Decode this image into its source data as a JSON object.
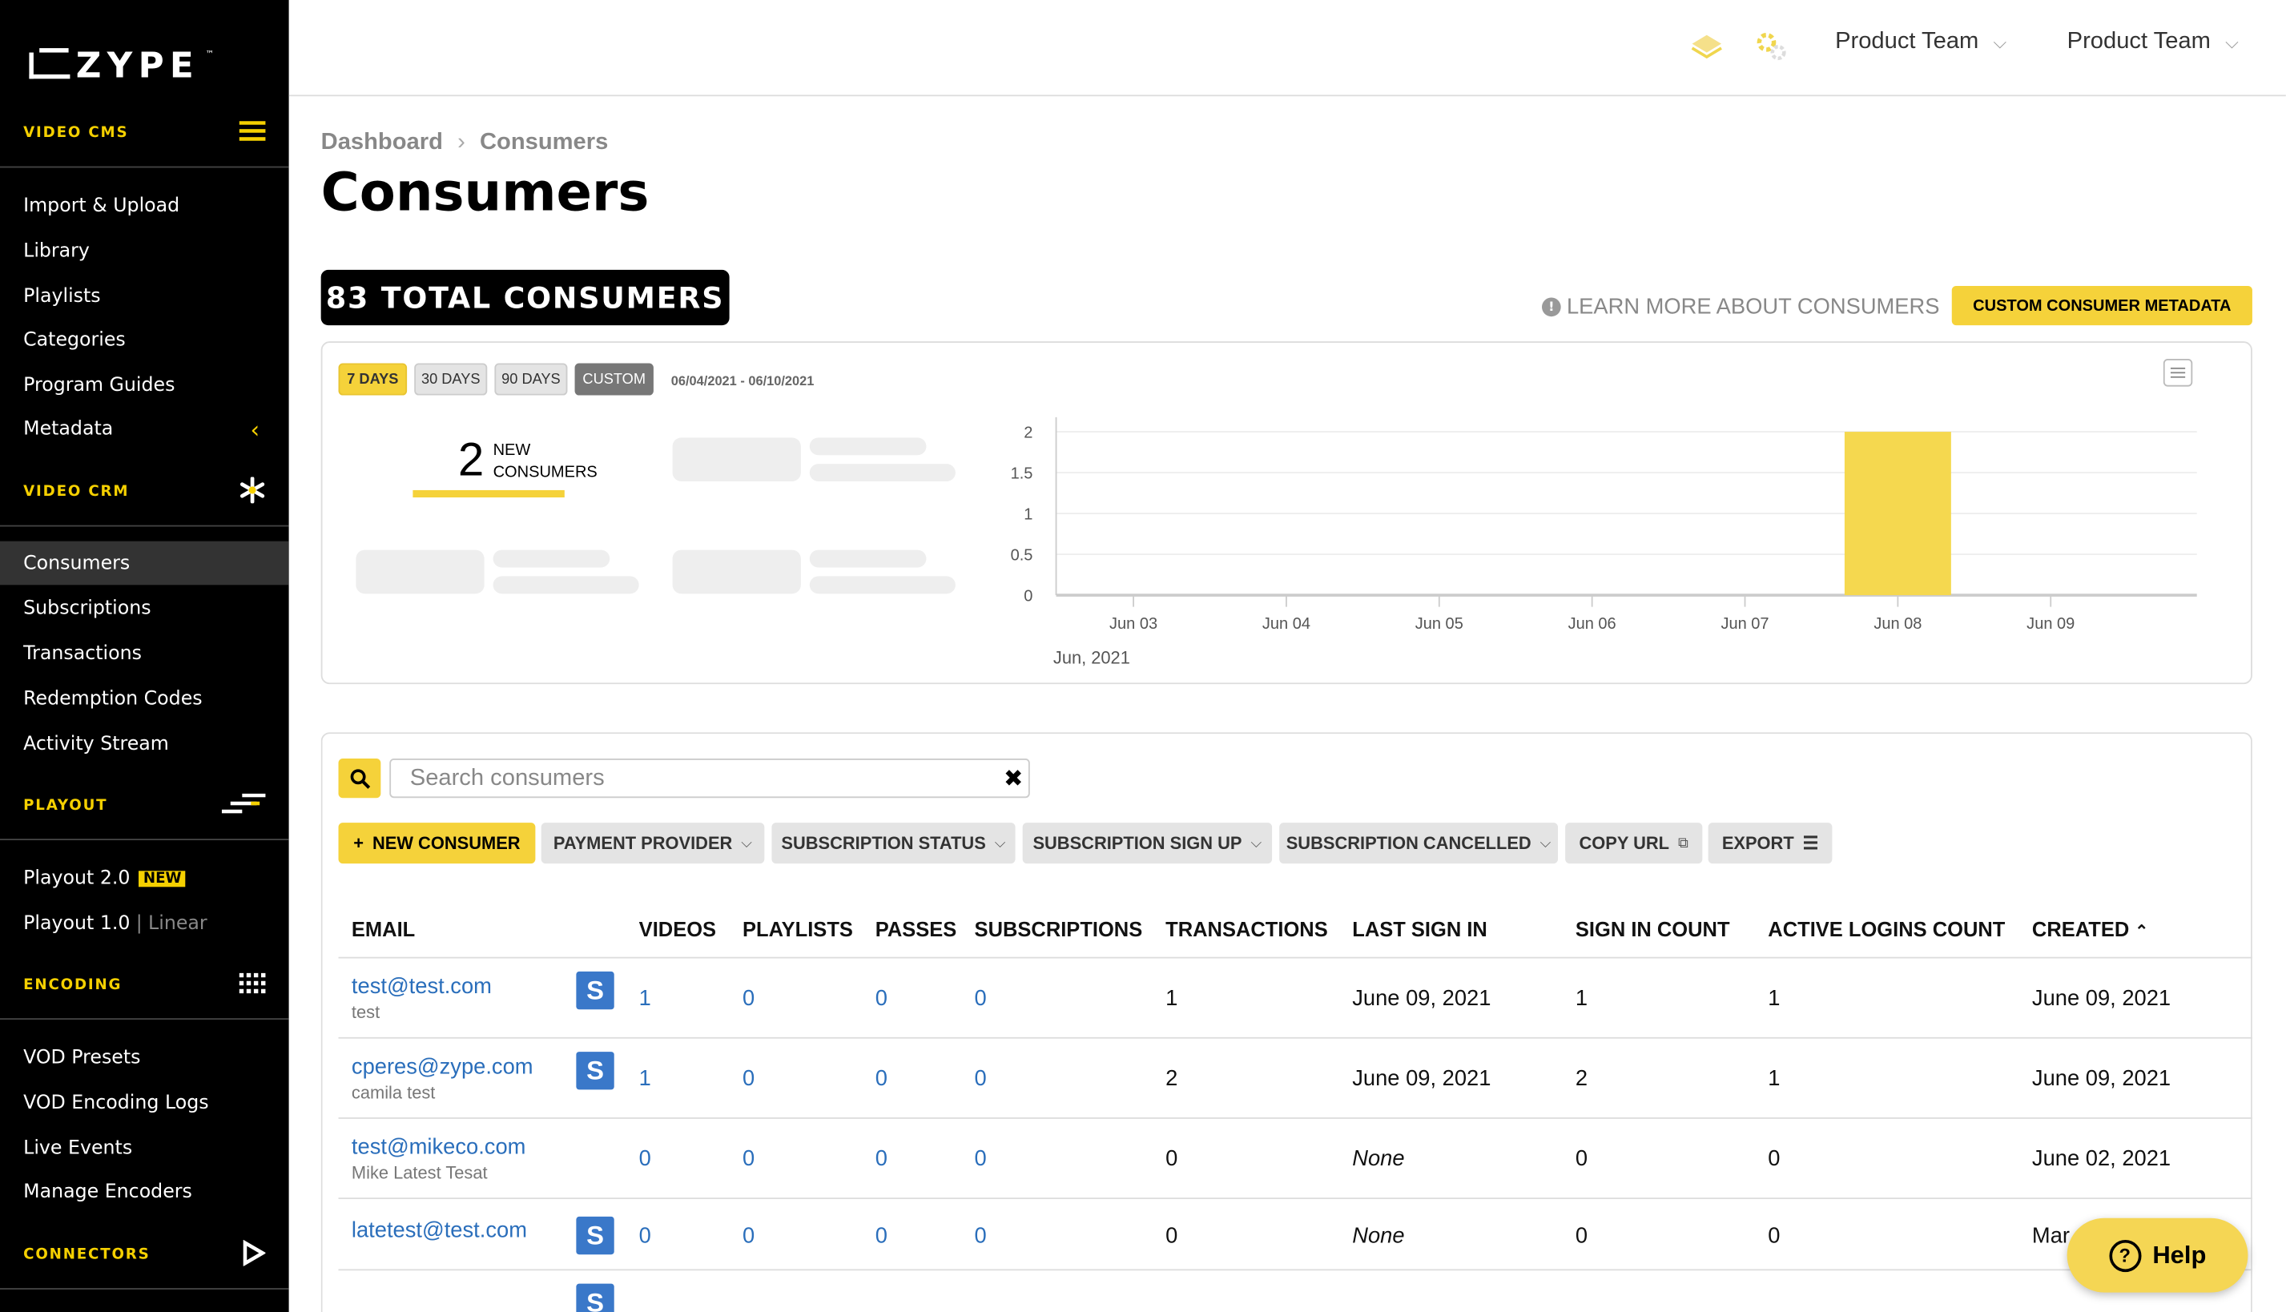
{
  "brand": {
    "name": "ZYPE",
    "tm": "™"
  },
  "sidebar": {
    "sections": [
      {
        "label": "VIDEO CMS",
        "icon": "hamburger-icon"
      },
      {
        "label": "VIDEO CRM",
        "icon": "asterisk-icon"
      },
      {
        "label": "PLAYOUT",
        "icon": "playout-icon"
      },
      {
        "label": "ENCODING",
        "icon": "grid-icon"
      },
      {
        "label": "CONNECTORS",
        "icon": "play-icon"
      }
    ],
    "cms_items": [
      "Import & Upload",
      "Library",
      "Playlists",
      "Categories",
      "Program Guides",
      "Metadata"
    ],
    "crm_items": [
      "Consumers",
      "Subscriptions",
      "Transactions",
      "Redemption Codes",
      "Activity Stream"
    ],
    "playout_items": [
      {
        "label": "Playout 2.0",
        "badge": "NEW"
      },
      {
        "label": "Playout 1.0",
        "sep": "|",
        "extra": "Linear"
      }
    ],
    "encoding_items": [
      "VOD Presets",
      "VOD Encoding Logs",
      "Live Events",
      "Manage Encoders"
    ]
  },
  "topbar": {
    "team1": "Product Team",
    "team2": "Product Team"
  },
  "breadcrumb": {
    "root": "Dashboard",
    "current": "Consumers"
  },
  "page_title": "Consumers",
  "total_badge": "83 TOTAL CONSUMERS",
  "learn_more": "LEARN MORE ABOUT CONSUMERS",
  "custom_meta_button": "CUSTOM CONSUMER METADATA",
  "ranges": [
    "7 DAYS",
    "30 DAYS",
    "90 DAYS",
    "CUSTOM"
  ],
  "selected_range": "7 DAYS",
  "date_range": "06/04/2021 - 06/10/2021",
  "stat": {
    "value": "2",
    "label_line1": "NEW",
    "label_line2": "CONSUMERS"
  },
  "chart_data": {
    "type": "bar",
    "categories": [
      "Jun 03",
      "Jun 04",
      "Jun 05",
      "Jun 06",
      "Jun 07",
      "Jun 08",
      "Jun 09"
    ],
    "values": [
      0,
      0,
      0,
      0,
      0,
      2,
      0
    ],
    "y_ticks": [
      "0",
      "0.5",
      "1",
      "1.5",
      "2"
    ],
    "ylim": [
      0,
      2
    ],
    "xlabel": "Jun, 2021",
    "grid": true,
    "bar_color": "#f5d84f"
  },
  "search": {
    "placeholder": "Search consumers",
    "clear": "✖"
  },
  "filters": {
    "new_consumer": "NEW CONSUMER",
    "payment_provider": "PAYMENT PROVIDER",
    "subscription_status": "SUBSCRIPTION STATUS",
    "subscription_sign_up": "SUBSCRIPTION SIGN UP",
    "subscription_cancelled": "SUBSCRIPTION CANCELLED",
    "copy_url": "COPY URL",
    "export": "EXPORT"
  },
  "table": {
    "headers": [
      "EMAIL",
      "VIDEOS",
      "PLAYLISTS",
      "PASSES",
      "SUBSCRIPTIONS",
      "TRANSACTIONS",
      "LAST SIGN IN",
      "SIGN IN COUNT",
      "ACTIVE LOGINS COUNT",
      "CREATED"
    ],
    "rows": [
      {
        "email": "test@test.com",
        "name": "test",
        "stripe": true,
        "videos": "1",
        "playlists": "0",
        "passes": "0",
        "subscriptions": "0",
        "transactions": "1",
        "last_sign_in": "June 09, 2021",
        "sign_in_count": "1",
        "active_logins": "1",
        "created": "June 09, 2021"
      },
      {
        "email": "cperes@zype.com",
        "name": "camila test",
        "stripe": true,
        "videos": "1",
        "playlists": "0",
        "passes": "0",
        "subscriptions": "0",
        "transactions": "2",
        "last_sign_in": "June 09, 2021",
        "sign_in_count": "2",
        "active_logins": "1",
        "created": "June 09, 2021"
      },
      {
        "email": "test@mikeco.com",
        "name": "Mike Latest Tesat",
        "stripe": false,
        "videos": "0",
        "playlists": "0",
        "passes": "0",
        "subscriptions": "0",
        "transactions": "0",
        "last_sign_in": "None",
        "sign_in_count": "0",
        "active_logins": "0",
        "created": "June 02, 2021"
      },
      {
        "email": "latetest@test.com",
        "name": "",
        "stripe": true,
        "videos": "0",
        "playlists": "0",
        "passes": "0",
        "subscriptions": "0",
        "transactions": "0",
        "last_sign_in": "None",
        "sign_in_count": "0",
        "active_logins": "0",
        "created": "Mar"
      }
    ]
  },
  "help_label": "Help",
  "colors": {
    "accent": "#f5d23a",
    "link": "#2a6ebb",
    "stripe": "#3a78c9"
  }
}
